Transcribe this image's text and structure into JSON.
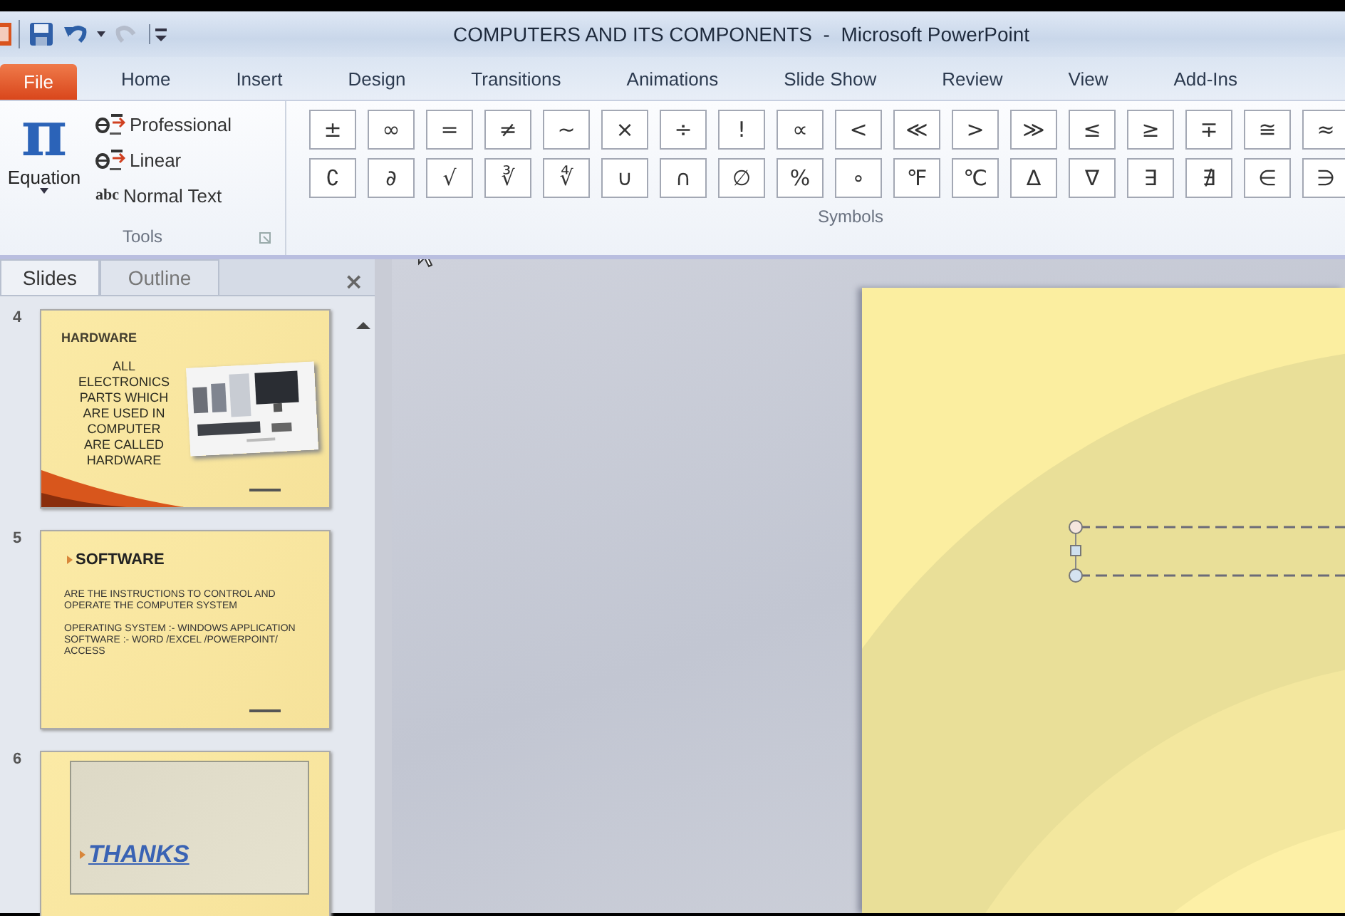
{
  "window": {
    "title": "COMPUTERS AND ITS COMPONENTS  -  Microsoft PowerPoint"
  },
  "ribbon_tabs": [
    {
      "label": "File",
      "kind": "file"
    },
    {
      "label": "Home",
      "kind": "tab"
    },
    {
      "label": "Insert",
      "kind": "tab"
    },
    {
      "label": "Design",
      "kind": "tab"
    },
    {
      "label": "Transitions",
      "kind": "tab"
    },
    {
      "label": "Animations",
      "kind": "tab"
    },
    {
      "label": "Slide Show",
      "kind": "tab"
    },
    {
      "label": "Review",
      "kind": "tab"
    },
    {
      "label": "View",
      "kind": "tab"
    },
    {
      "label": "Add-Ins",
      "kind": "tab"
    }
  ],
  "tools_group": {
    "label": "Tools",
    "equation": "Equation",
    "symbol": "π",
    "options": [
      {
        "kind": "equation",
        "label": "Professional"
      },
      {
        "kind": "equation",
        "label": "Linear"
      },
      {
        "kind": "text",
        "prefix": "abc",
        "label": "Normal Text"
      }
    ]
  },
  "symbols_group": {
    "label": "Symbols",
    "rows": [
      [
        "±",
        "∞",
        "=",
        "≠",
        "~",
        "×",
        "÷",
        "!",
        "∝",
        "<",
        "≪",
        ">",
        "≫",
        "≤",
        "≥",
        "∓",
        "≅",
        "≈"
      ],
      [
        "∁",
        "∂",
        "√",
        "∛",
        "∜",
        "∪",
        "∩",
        "∅",
        "%",
        "∘",
        "℉",
        "℃",
        "∆",
        "∇",
        "∃",
        "∄",
        "∈",
        "∋"
      ]
    ]
  },
  "slides_pane": {
    "tabs": [
      {
        "label": "Slides",
        "selected": true
      },
      {
        "label": "Outline",
        "selected": false
      }
    ],
    "close": "×",
    "slides": [
      {
        "number": "4",
        "kind": "picture_text",
        "title": "HARDWARE",
        "body": [
          "ALL",
          "ELECTRONICS",
          "PARTS WHICH",
          "ARE USED IN",
          "COMPUTER",
          "ARE CALLED",
          "HARDWARE"
        ]
      },
      {
        "number": "5",
        "kind": "bullets",
        "title": "SOFTWARE",
        "body": [
          "ARE THE INSTRUCTIONS TO CONTROL AND OPERATE THE COMPUTER SYSTEM",
          "OPERATING SYSTEM :- WINDOWS APPLICATION SOFTWARE :- WORD /EXCEL /POWERPOINT/ ACCESS"
        ]
      },
      {
        "number": "6",
        "kind": "title",
        "title": "THANKS"
      }
    ]
  }
}
